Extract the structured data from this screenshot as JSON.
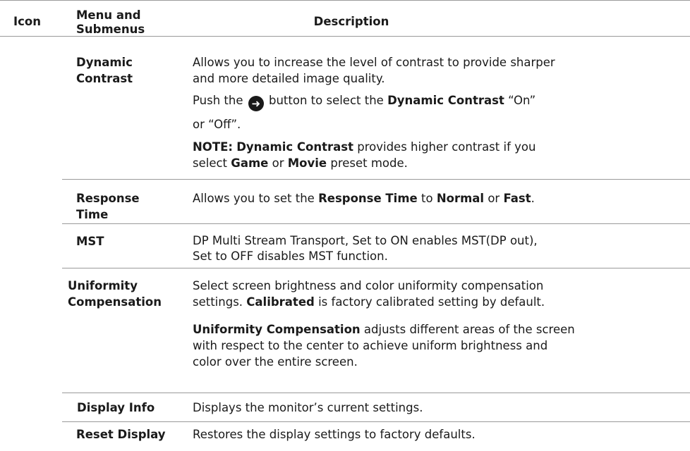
{
  "header": {
    "icon": "Icon",
    "menu_line1": "Menu and",
    "menu_line2": "Submenus",
    "description": "Description"
  },
  "rows": [
    {
      "menu_line1": "Dynamic",
      "menu_line2": "Contrast",
      "p1_line1": "Allows you to increase the level of contrast to provide sharper",
      "p1_line2": "and more detailed image quality.",
      "p2_pre": "Push the",
      "p2_icon": "arrow-right-circle-icon",
      "p2_mid": "button to select the",
      "p2_bold": "Dynamic Contrast",
      "p2_post": "“On”",
      "p3": "or “Off”.",
      "note_label": "NOTE:",
      "note_bold": "Dynamic Contrast",
      "note_text1": "provides higher contrast if you",
      "note_text2a": "select",
      "note_game": "Game",
      "note_or": "or",
      "note_movie": "Movie",
      "note_text2b": "preset mode."
    },
    {
      "menu_line1": "Response",
      "menu_line2": "Time",
      "text_a": "Allows you to set the",
      "bold_a": "Response Time",
      "text_b": "to",
      "bold_b": "Normal",
      "text_c": "or",
      "bold_c": "Fast",
      "text_d": "."
    },
    {
      "menu": "MST",
      "line1": "DP Multi Stream Transport,  Set to ON enables MST(DP out),",
      "line2": "Set to OFF disables MST function."
    },
    {
      "menu_line1": "Uniformity",
      "menu_line2": "Compensation",
      "p1_line1": "Select screen brightness and color uniformity compensation",
      "p1_line2a": "settings.",
      "p1_bold": "Calibrated",
      "p1_line2b": "is factory calibrated setting by default.",
      "p2_bold": "Uniformity Compensation",
      "p2_line1": "adjusts different areas of the screen",
      "p2_line2": "with respect to the center to achieve uniform brightness and",
      "p2_line3": "color over the entire screen."
    },
    {
      "menu": "Display Info",
      "text": "Displays the monitor’s current settings."
    },
    {
      "menu": "Reset Display",
      "text": "Restores the display settings to factory defaults."
    }
  ]
}
